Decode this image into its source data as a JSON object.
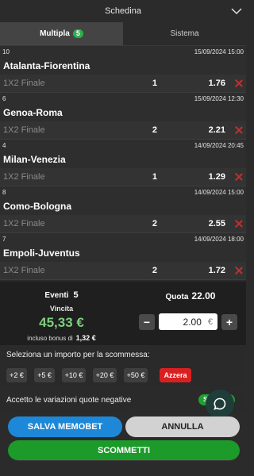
{
  "header": {
    "title": "Schedina"
  },
  "tabs": [
    {
      "label": "Multipla",
      "badge": "5"
    },
    {
      "label": "Sistema"
    }
  ],
  "bets": [
    {
      "id": "10",
      "datetime": "15/09/2024 15:00",
      "match": "Atalanta-Fiorentina",
      "market": "1X2 Finale",
      "selection": "1",
      "odd": "1.76"
    },
    {
      "id": "6",
      "datetime": "15/09/2024 12:30",
      "match": "Genoa-Roma",
      "market": "1X2 Finale",
      "selection": "2",
      "odd": "2.21"
    },
    {
      "id": "4",
      "datetime": "14/09/2024 20:45",
      "match": "Milan-Venezia",
      "market": "1X2 Finale",
      "selection": "1",
      "odd": "1.29"
    },
    {
      "id": "8",
      "datetime": "14/09/2024 15:00",
      "match": "Como-Bologna",
      "market": "1X2 Finale",
      "selection": "2",
      "odd": "2.55"
    },
    {
      "id": "7",
      "datetime": "14/09/2024 18:00",
      "match": "Empoli-Juventus",
      "market": "1X2 Finale",
      "selection": "2",
      "odd": "1.72"
    }
  ],
  "summary": {
    "eventi_label": "Eventi",
    "eventi_value": "5",
    "quota_label": "Quota",
    "quota_value": "22.00",
    "vincita_label": "Vincita",
    "vincita_value": "45,33 €",
    "bonus_label": "incluso bonus di",
    "bonus_value": "1,32 €",
    "stake_value": "2.00",
    "currency": "€",
    "minus": "−",
    "plus": "+"
  },
  "amounts": {
    "label": "Seleziona un importo per la scommessa:",
    "options": [
      "+2 €",
      "+5 €",
      "+10 €",
      "+20 €",
      "+50 €"
    ],
    "reset": "Azzera"
  },
  "accept": {
    "label": "Accetto le variazioni quote negative",
    "toggle": "SI"
  },
  "buttons": {
    "save": "SALVA MEMOBET",
    "cancel": "ANNULLA",
    "bet": "SCOMMETTI"
  },
  "colors": {
    "accent_green": "#1c9a2a",
    "win_green": "#7ed07e",
    "save_blue": "#1e88d8",
    "reset_red": "#d92020"
  }
}
